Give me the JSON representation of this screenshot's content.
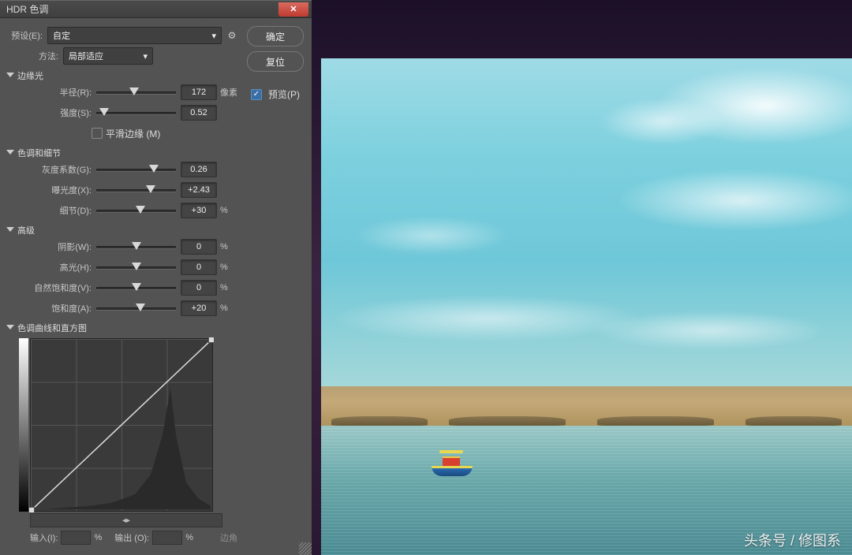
{
  "dialog": {
    "title": "HDR 色调",
    "preset_label": "预设(E):",
    "preset_value": "自定",
    "method_label": "方法:",
    "method_value": "局部适应",
    "buttons": {
      "ok": "确定",
      "reset": "复位"
    },
    "preview_label": "预览(P)"
  },
  "sections": {
    "edge": {
      "title": "边缘光",
      "radius_label": "半径(R):",
      "radius_value": "172",
      "radius_unit": "像素",
      "strength_label": "强度(S):",
      "strength_value": "0.52",
      "smooth_label": "平滑边缘 (M)"
    },
    "tone": {
      "title": "色调和细节",
      "gamma_label": "灰度系数(G):",
      "gamma_value": "0.26",
      "exposure_label": "曝光度(X):",
      "exposure_value": "+2.43",
      "detail_label": "细节(D):",
      "detail_value": "+30",
      "pct": "%"
    },
    "adv": {
      "title": "高级",
      "shadow_label": "阴影(W):",
      "shadow_value": "0",
      "highlight_label": "高光(H):",
      "highlight_value": "0",
      "vibrance_label": "自然饱和度(V):",
      "vibrance_value": "0",
      "saturation_label": "饱和度(A):",
      "saturation_value": "+20",
      "pct": "%"
    },
    "curve": {
      "title": "色调曲线和直方图",
      "input_label": "输入(I):",
      "output_label": "输出 (O):",
      "pct": "%",
      "corner_label": "边角"
    }
  },
  "watermark": "头条号 / 修图系"
}
